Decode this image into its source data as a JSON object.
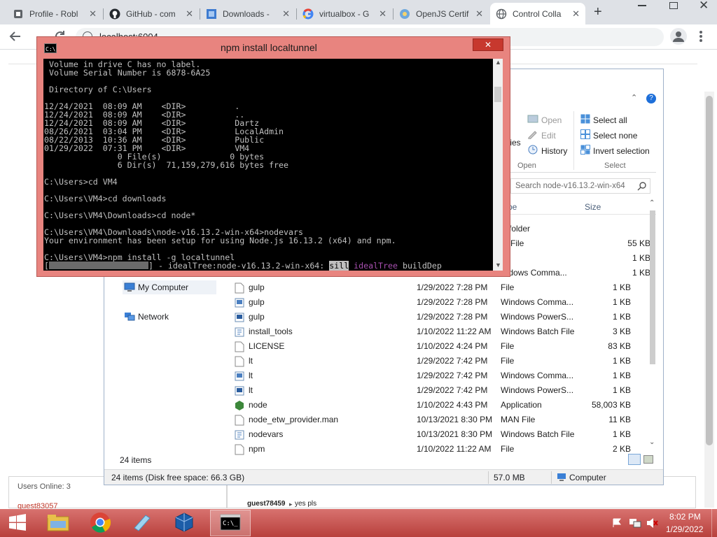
{
  "browser": {
    "tabs": [
      {
        "label": "Profile - Robl",
        "icon": "profile-icon"
      },
      {
        "label": "GitHub - com",
        "icon": "github-icon"
      },
      {
        "label": "Downloads - ",
        "icon": "downloads-icon"
      },
      {
        "label": "virtualbox - G",
        "icon": "google-icon"
      },
      {
        "label": "OpenJS Certif",
        "icon": "openjs-icon"
      },
      {
        "label": "Control Colla",
        "icon": "globe-icon"
      }
    ],
    "close_glyph": "✕",
    "new_tab_glyph": "+",
    "address": "localhost:6004"
  },
  "chat": {
    "users_online": "Users Online: 3",
    "user_partial": "guest83057",
    "message_user": "guest78459",
    "message_text": "yes pls"
  },
  "explorer": {
    "ribbon": {
      "open_label": "Open",
      "edit_label": "Edit",
      "history_label": "History",
      "properties_partial": "ties",
      "open_group": "Open",
      "select_all": "Select all",
      "select_none": "Select none",
      "invert_selection": "Invert selection",
      "select_group": "Select"
    },
    "search_placeholder": "Search node-v16.13.2-win-x64",
    "columns": {
      "type": "pe",
      "size": "Size"
    },
    "partial_rows": [
      {
        "type": "e folder",
        "size": ""
      },
      {
        "type": "D File",
        "size": "55 KB"
      },
      {
        "type": "e",
        "size": "1 KB"
      },
      {
        "type": "indows Comma...",
        "size": "1 KB"
      }
    ],
    "nav": {
      "my_computer": "My Computer",
      "network": "Network"
    },
    "files": [
      {
        "name": "gulp",
        "date": "1/29/2022 7:28 PM",
        "type": "File",
        "size": "1 KB",
        "icon": "file-icon"
      },
      {
        "name": "gulp",
        "date": "1/29/2022 7:28 PM",
        "type": "Windows Comma...",
        "size": "1 KB",
        "icon": "cmd-file-icon"
      },
      {
        "name": "gulp",
        "date": "1/29/2022 7:28 PM",
        "type": "Windows PowerS...",
        "size": "1 KB",
        "icon": "ps-file-icon"
      },
      {
        "name": "install_tools",
        "date": "1/10/2022 11:22 AM",
        "type": "Windows Batch File",
        "size": "3 KB",
        "icon": "bat-file-icon"
      },
      {
        "name": "LICENSE",
        "date": "1/10/2022 4:24 PM",
        "type": "File",
        "size": "83 KB",
        "icon": "file-icon"
      },
      {
        "name": "lt",
        "date": "1/29/2022 7:42 PM",
        "type": "File",
        "size": "1 KB",
        "icon": "file-icon"
      },
      {
        "name": "lt",
        "date": "1/29/2022 7:42 PM",
        "type": "Windows Comma...",
        "size": "1 KB",
        "icon": "cmd-file-icon"
      },
      {
        "name": "lt",
        "date": "1/29/2022 7:42 PM",
        "type": "Windows PowerS...",
        "size": "1 KB",
        "icon": "ps-file-icon"
      },
      {
        "name": "node",
        "date": "1/10/2022 4:43 PM",
        "type": "Application",
        "size": "58,003 KB",
        "icon": "node-app-icon"
      },
      {
        "name": "node_etw_provider.man",
        "date": "10/13/2021 8:30 PM",
        "type": "MAN File",
        "size": "11 KB",
        "icon": "file-icon"
      },
      {
        "name": "nodevars",
        "date": "10/13/2021 8:30 PM",
        "type": "Windows Batch File",
        "size": "1 KB",
        "icon": "bat-file-icon"
      },
      {
        "name": "npm",
        "date": "1/10/2022 11:22 AM",
        "type": "File",
        "size": "2 KB",
        "icon": "file-icon"
      }
    ],
    "item_count": "24 items",
    "status_left": "24 items (Disk free space: 66.3 GB)",
    "status_size": "57.0 MB",
    "status_location": "Computer"
  },
  "cmd": {
    "title": "npm install localtunnel",
    "lines": [
      " Volume in drive C has no label.",
      " Volume Serial Number is 6878-6A25",
      "",
      " Directory of C:\\Users",
      "",
      "12/24/2021  08:09 AM    <DIR>          .",
      "12/24/2021  08:09 AM    <DIR>          ..",
      "12/24/2021  08:09 AM    <DIR>          Dartz",
      "08/26/2021  03:04 PM    <DIR>          LocalAdmin",
      "08/22/2013  10:36 AM    <DIR>          Public",
      "01/29/2022  07:31 PM    <DIR>          VM4",
      "               0 File(s)              0 bytes",
      "               6 Dir(s)  71,159,279,616 bytes free",
      "",
      "C:\\Users>cd VM4",
      "",
      "C:\\Users\\VM4>cd downloads",
      "",
      "C:\\Users\\VM4\\Downloads>cd node*",
      "",
      "C:\\Users\\VM4\\Downloads\\node-v16.13.2-win-x64>nodevars",
      "Your environment has been setup for using Node.js 16.13.2 (x64) and npm.",
      "",
      "C:\\Users\\VM4>npm install -g localtunnel"
    ],
    "progress_open": "[",
    "progress_close": "] - idealTree:node-v16.13.2-win-x64: ",
    "progress_level": "sill",
    "progress_stage": "idealTree",
    "progress_tail": " buildDep"
  },
  "taskbar": {
    "time": "8:02 PM",
    "date": "1/29/2022",
    "apps": [
      "file-explorer-icon",
      "chrome-icon",
      "notepad-icon",
      "virtualbox-icon",
      "cmd-icon"
    ]
  }
}
